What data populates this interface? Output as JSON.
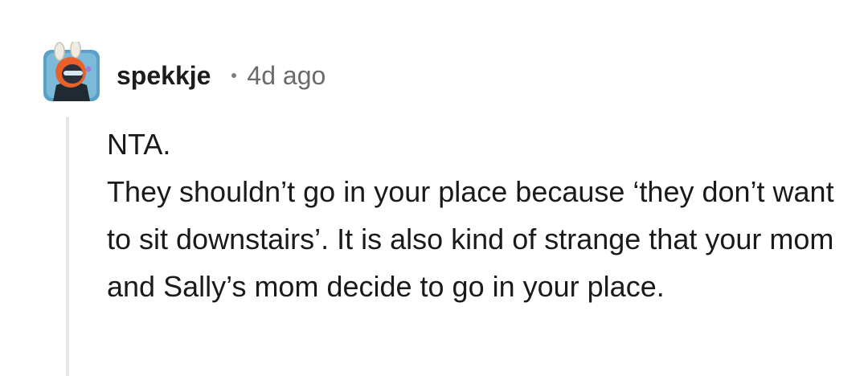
{
  "comment": {
    "username": "spekkje",
    "timestamp": "4d ago",
    "avatar_icon": "snoo-avatar-icon",
    "body_lines": [
      "NTA.",
      "They shouldn’t go in your place because ‘they don’t want to sit downstairs’. It is also kind of strange that your mom and Sally’s mom decide to go in your place."
    ]
  },
  "colors": {
    "username": "#1c1c1c",
    "timestamp": "#6a6a6a",
    "thread_line": "#e6e6e6",
    "avatar_bg": "#5aa0c8"
  }
}
